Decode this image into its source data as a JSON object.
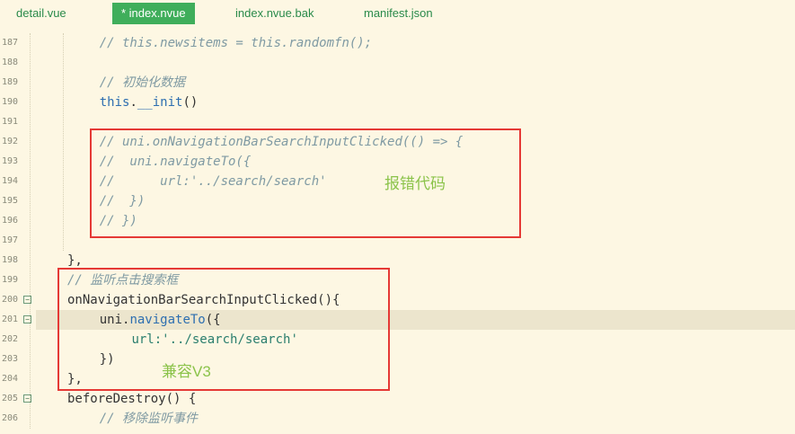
{
  "tabs": [
    {
      "label": "detail.vue",
      "active": false
    },
    {
      "label": "* index.nvue",
      "active": true
    },
    {
      "label": "index.nvue.bak",
      "active": false
    },
    {
      "label": "manifest.json",
      "active": false
    }
  ],
  "lines": [
    {
      "n": "187",
      "segs": [
        {
          "c": "cm",
          "t": "// this.newsitems = this.randomfn();"
        }
      ],
      "indent": 2
    },
    {
      "n": "188",
      "segs": [],
      "indent": 0
    },
    {
      "n": "189",
      "segs": [
        {
          "c": "cm",
          "t": "// 初始化数据"
        }
      ],
      "indent": 2
    },
    {
      "n": "190",
      "segs": [
        {
          "c": "kw",
          "t": "this"
        },
        {
          "c": "br",
          "t": "."
        },
        {
          "c": "fn",
          "t": "__init"
        },
        {
          "c": "br",
          "t": "()"
        }
      ],
      "indent": 2
    },
    {
      "n": "191",
      "segs": [],
      "indent": 0
    },
    {
      "n": "192",
      "segs": [
        {
          "c": "cm",
          "t": "// uni.onNavigationBarSearchInputClicked(() => {"
        }
      ],
      "indent": 2
    },
    {
      "n": "193",
      "segs": [
        {
          "c": "cm",
          "t": "//  uni.navigateTo({"
        }
      ],
      "indent": 2
    },
    {
      "n": "194",
      "segs": [
        {
          "c": "cm",
          "t": "//      url:'../search/search'"
        }
      ],
      "indent": 2
    },
    {
      "n": "195",
      "segs": [
        {
          "c": "cm",
          "t": "//  })"
        }
      ],
      "indent": 2
    },
    {
      "n": "196",
      "segs": [
        {
          "c": "cm",
          "t": "// })"
        }
      ],
      "indent": 2
    },
    {
      "n": "197",
      "segs": [],
      "indent": 0
    },
    {
      "n": "198",
      "segs": [
        {
          "c": "br",
          "t": "},"
        }
      ],
      "indent": 1
    },
    {
      "n": "199",
      "segs": [
        {
          "c": "cm",
          "t": "// 监听点击搜索框"
        }
      ],
      "indent": 1
    },
    {
      "n": "200",
      "segs": [
        {
          "c": "br",
          "t": "onNavigationBarSearchInputClicked(){"
        }
      ],
      "indent": 1,
      "fold": "⊟"
    },
    {
      "n": "201",
      "segs": [
        {
          "c": "br",
          "t": "uni."
        },
        {
          "c": "fn",
          "t": "navigateTo"
        },
        {
          "c": "br",
          "t": "({"
        }
      ],
      "indent": 2,
      "fold": "⊟",
      "highlight": true
    },
    {
      "n": "202",
      "segs": [
        {
          "c": "str",
          "t": "url:'../search/search'"
        }
      ],
      "indent": 3
    },
    {
      "n": "203",
      "segs": [
        {
          "c": "br",
          "t": "})"
        }
      ],
      "indent": 2
    },
    {
      "n": "204",
      "segs": [
        {
          "c": "br",
          "t": "},"
        }
      ],
      "indent": 1
    },
    {
      "n": "205",
      "segs": [
        {
          "c": "br",
          "t": "beforeDestroy() {"
        }
      ],
      "indent": 1,
      "fold": "⊟"
    },
    {
      "n": "206",
      "segs": [
        {
          "c": "cm",
          "t": "// 移除监听事件"
        }
      ],
      "indent": 2
    }
  ],
  "annotations": {
    "error_label": "报错代码",
    "compat_label": "兼容V3"
  },
  "colors": {
    "background": "#fdf7e3",
    "active_tab": "#3fae5b",
    "highlight_line": "#ece5cd",
    "box_border": "#e53935",
    "annotation_text": "#8bc34a"
  }
}
